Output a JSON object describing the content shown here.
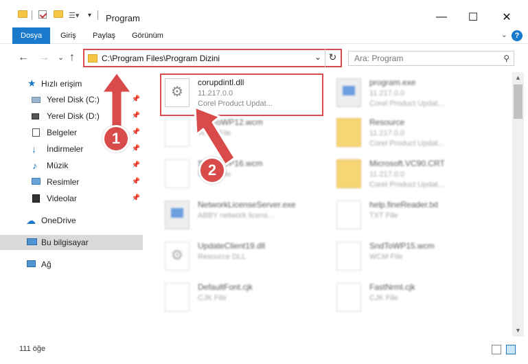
{
  "window": {
    "title": "Program",
    "minimize_glyph": "—",
    "maximize_glyph": "☐",
    "close_glyph": "✕"
  },
  "ribbon": {
    "tabs": [
      {
        "label": "Dosya",
        "active": true
      },
      {
        "label": "Giriş",
        "active": false
      },
      {
        "label": "Paylaş",
        "active": false
      },
      {
        "label": "Görünüm",
        "active": false
      }
    ],
    "help_glyph": "?",
    "expand_glyph": "⌄"
  },
  "addressbar": {
    "back_glyph": "←",
    "forward_glyph": "→",
    "recent_glyph": "⌄",
    "up_glyph": "↑",
    "path": "C:\\Program Files\\Program Dizini",
    "dropdown_glyph": "⌄",
    "refresh_glyph": "↻"
  },
  "search": {
    "placeholder": "Ara: Program",
    "icon": "search-icon",
    "glyph": "⚲"
  },
  "navpane": {
    "quick_access": "Hızlı erişim",
    "items": [
      {
        "label": "Yerel Disk (C:)",
        "icon": "drive-icon",
        "pinned": true
      },
      {
        "label": "Yerel Disk (D:)",
        "icon": "drive-icon",
        "pinned": true
      },
      {
        "label": "Belgeler",
        "icon": "documents-icon",
        "pinned": true
      },
      {
        "label": "İndirmeler",
        "icon": "download-icon",
        "pinned": true
      },
      {
        "label": "Müzik",
        "icon": "music-icon",
        "pinned": true
      },
      {
        "label": "Resimler",
        "icon": "pictures-icon",
        "pinned": true
      },
      {
        "label": "Videolar",
        "icon": "videos-icon",
        "pinned": true
      }
    ],
    "onedrive": "OneDrive",
    "this_pc": "Bu bilgisayar",
    "network": "Ağ",
    "pin_glyph": "📌"
  },
  "files": [
    {
      "name": "corupdintl.dll",
      "line1": "11.217.0.0",
      "line2": "Corel Product Updat...",
      "type": "gear",
      "col": 0,
      "row": 0,
      "highlighted": true
    },
    {
      "name": "program.exe",
      "line1": "11.217.0.0",
      "line2": "Corel Product Updat...",
      "type": "exe",
      "col": 1,
      "row": 0
    },
    {
      "name": "SndToWP12.wcm",
      "line1": "WCM File",
      "line2": "",
      "type": "doc",
      "col": 0,
      "row": 1
    },
    {
      "name": "Resource",
      "line1": "11.217.0.0",
      "line2": "Corel Product Updat...",
      "type": "folder",
      "col": 1,
      "row": 1
    },
    {
      "name": "SndToWP16.wcm",
      "line1": "WCM File",
      "line2": "",
      "type": "doc",
      "col": 0,
      "row": 2
    },
    {
      "name": "Microsoft.VC90.CRT",
      "line1": "11.217.0.0",
      "line2": "Corel Product Updat...",
      "type": "folder",
      "col": 1,
      "row": 2
    },
    {
      "name": "NetworkLicenseServer.exe",
      "line1": "ABBY network licens...",
      "line2": "",
      "type": "exe",
      "col": 0,
      "row": 3
    },
    {
      "name": "help.fineReader.txt",
      "line1": "TXT File",
      "line2": "",
      "type": "doc",
      "col": 1,
      "row": 3
    },
    {
      "name": "UpdateClient19.dll",
      "line1": "Resource DLL",
      "line2": "",
      "type": "gear",
      "col": 0,
      "row": 4
    },
    {
      "name": "SndToWP15.wcm",
      "line1": "WCM File",
      "line2": "",
      "type": "doc",
      "col": 1,
      "row": 4
    },
    {
      "name": "DefaultFont.cjk",
      "line1": "CJK File",
      "line2": "",
      "type": "doc",
      "col": 0,
      "row": 5
    },
    {
      "name": "FastNrml.cjk",
      "line1": "CJK File",
      "line2": "",
      "type": "doc",
      "col": 1,
      "row": 5
    }
  ],
  "status": {
    "count": "111 öğe"
  },
  "annotations": {
    "badge1": "1",
    "badge2": "2",
    "color": "#d94a4a"
  },
  "colors": {
    "accent": "#1979ca",
    "highlight": "#d94a4a",
    "folder": "#f4c745"
  }
}
